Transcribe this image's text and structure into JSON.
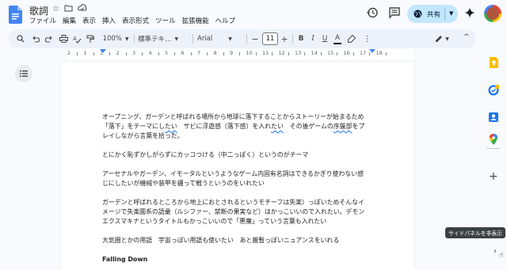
{
  "header": {
    "doc_title": "歌詞",
    "menu": [
      "ファイル",
      "編集",
      "表示",
      "挿入",
      "表示形式",
      "ツール",
      "拡張機能",
      "ヘルプ"
    ],
    "share_label": "共有",
    "icons": [
      "docs-logo-icon",
      "star-icon",
      "move-to-folder-icon",
      "cloud-status-icon",
      "history-icon",
      "comment-icon",
      "globe-icon",
      "gemini-icon",
      "avatar"
    ]
  },
  "toolbar": {
    "zoom": "100%",
    "style": "標準テキ…",
    "font": "Arial",
    "font_size": "11",
    "icons": [
      "search-icon",
      "undo-icon",
      "redo-icon",
      "print-icon",
      "spellcheck-icon",
      "paint-format-icon",
      "bold-icon",
      "italic-icon",
      "underline-icon",
      "text-color-icon",
      "highlight-icon",
      "more-icon",
      "edit-mode-icon",
      "collapse-icon"
    ]
  },
  "ruler": {
    "numbers": [
      "2",
      "1",
      "1",
      "2",
      "3",
      "4",
      "5",
      "6",
      "7",
      "8",
      "9",
      "10",
      "11",
      "12",
      "13",
      "14",
      "15",
      "16",
      "17",
      "18"
    ]
  },
  "document": {
    "p1_part1": "オープニング、ガーデンと呼ばれる場所から地球に落下することからストーリーが始まるため「落下」をテーマにし",
    "p1_sq1": "たい",
    "p1_part2": "　サビに浮遊感（落下感）を入れ",
    "p1_sq2": "たい",
    "p1_part3": "　その後ゲームの",
    "p1_sq3": "序盤部",
    "p1_part4": "をプレイしながら言葉を拾った。",
    "p2": "とにかく恥ずかしがらずにカッコつける（中二っぽく）というのがテーマ",
    "p3": "アーセナルやガーデン、イモータルというようなゲーム内固有名詞はできるかぎり使わない感じにしたいが機械や装甲を纏って戦うというのをいれたい",
    "p4": "ガーデンと呼ばれるところから地上におとされるというモチーフは失楽）っぽいためそんなイメージで失楽園系の語彙（ルシファー、禁断の果実など）はかっこいいので入れたい。デモンエクスマキナというタイトルもかっこいいので「悪魔」っていう言葉も入れたい",
    "p5": "大気圏とかの用語　宇宙っぽい用語も使いたい　あと厳暫っぽいニュアンスをいれる",
    "heading": "Falling Down"
  },
  "side_panel": {
    "tooltip": "サイドパネルを非表示",
    "icons": [
      "keep-icon",
      "tasks-icon",
      "contacts-icon",
      "maps-icon",
      "add-icon",
      "chevron-right-icon"
    ]
  }
}
